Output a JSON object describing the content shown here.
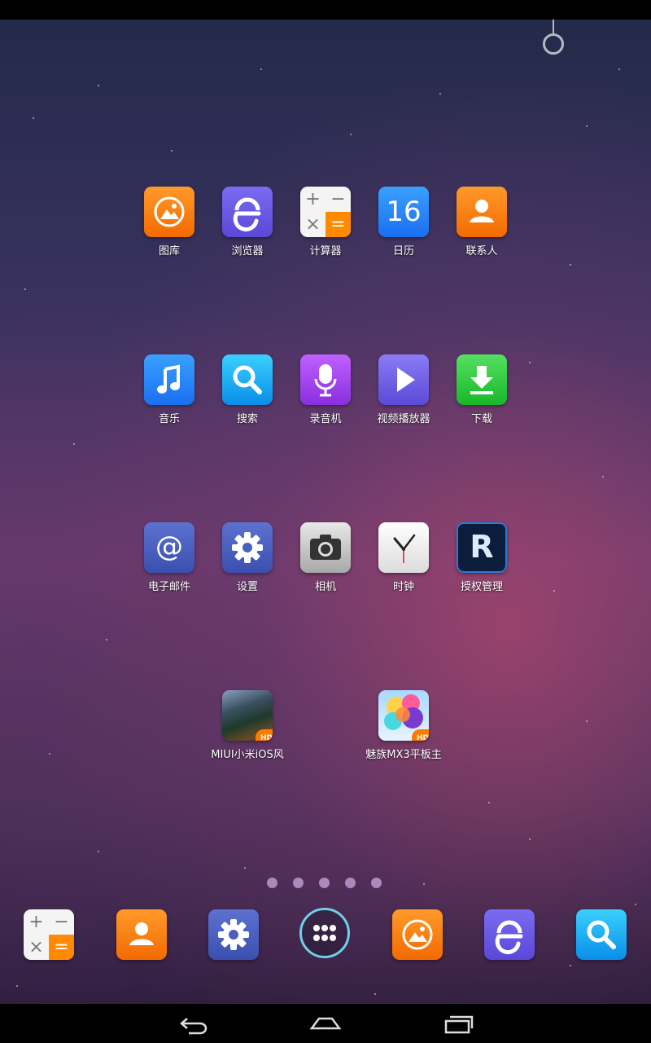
{
  "home": {
    "apps": [
      {
        "label": "图库",
        "icon": "gallery-icon"
      },
      {
        "label": "浏览器",
        "icon": "browser-icon"
      },
      {
        "label": "计算器",
        "icon": "calculator-icon"
      },
      {
        "label": "日历",
        "icon": "calendar-icon",
        "day": "16"
      },
      {
        "label": "联系人",
        "icon": "contacts-icon"
      },
      {
        "label": "音乐",
        "icon": "music-icon"
      },
      {
        "label": "搜索",
        "icon": "search-icon"
      },
      {
        "label": "录音机",
        "icon": "recorder-icon"
      },
      {
        "label": "视频播放器",
        "icon": "video-player-icon"
      },
      {
        "label": "下载",
        "icon": "download-icon"
      },
      {
        "label": "电子邮件",
        "icon": "email-icon",
        "glyph": "@"
      },
      {
        "label": "设置",
        "icon": "settings-icon"
      },
      {
        "label": "相机",
        "icon": "camera-icon"
      },
      {
        "label": "时钟",
        "icon": "clock-icon"
      },
      {
        "label": "授权管理",
        "icon": "superuser-icon",
        "glyph": "R"
      },
      {
        "label": "MIUI小米iOS风",
        "icon": "miui-theme-icon",
        "badge": "HD"
      },
      {
        "label": "魅族MX3平板主",
        "icon": "meizu-theme-icon",
        "badge": "HD"
      }
    ],
    "calculator_symbols": [
      "+",
      "−",
      "×",
      "="
    ],
    "page_indicator": {
      "count": 5
    }
  },
  "dock": {
    "items": [
      {
        "icon": "calculator-icon"
      },
      {
        "icon": "contacts-icon"
      },
      {
        "icon": "settings-icon"
      },
      {
        "icon": "app-drawer-icon"
      },
      {
        "icon": "gallery-icon"
      },
      {
        "icon": "browser-icon"
      },
      {
        "icon": "search-icon"
      }
    ]
  },
  "navbar": {
    "buttons": [
      "back-icon",
      "home-icon",
      "recent-apps-icon"
    ]
  }
}
